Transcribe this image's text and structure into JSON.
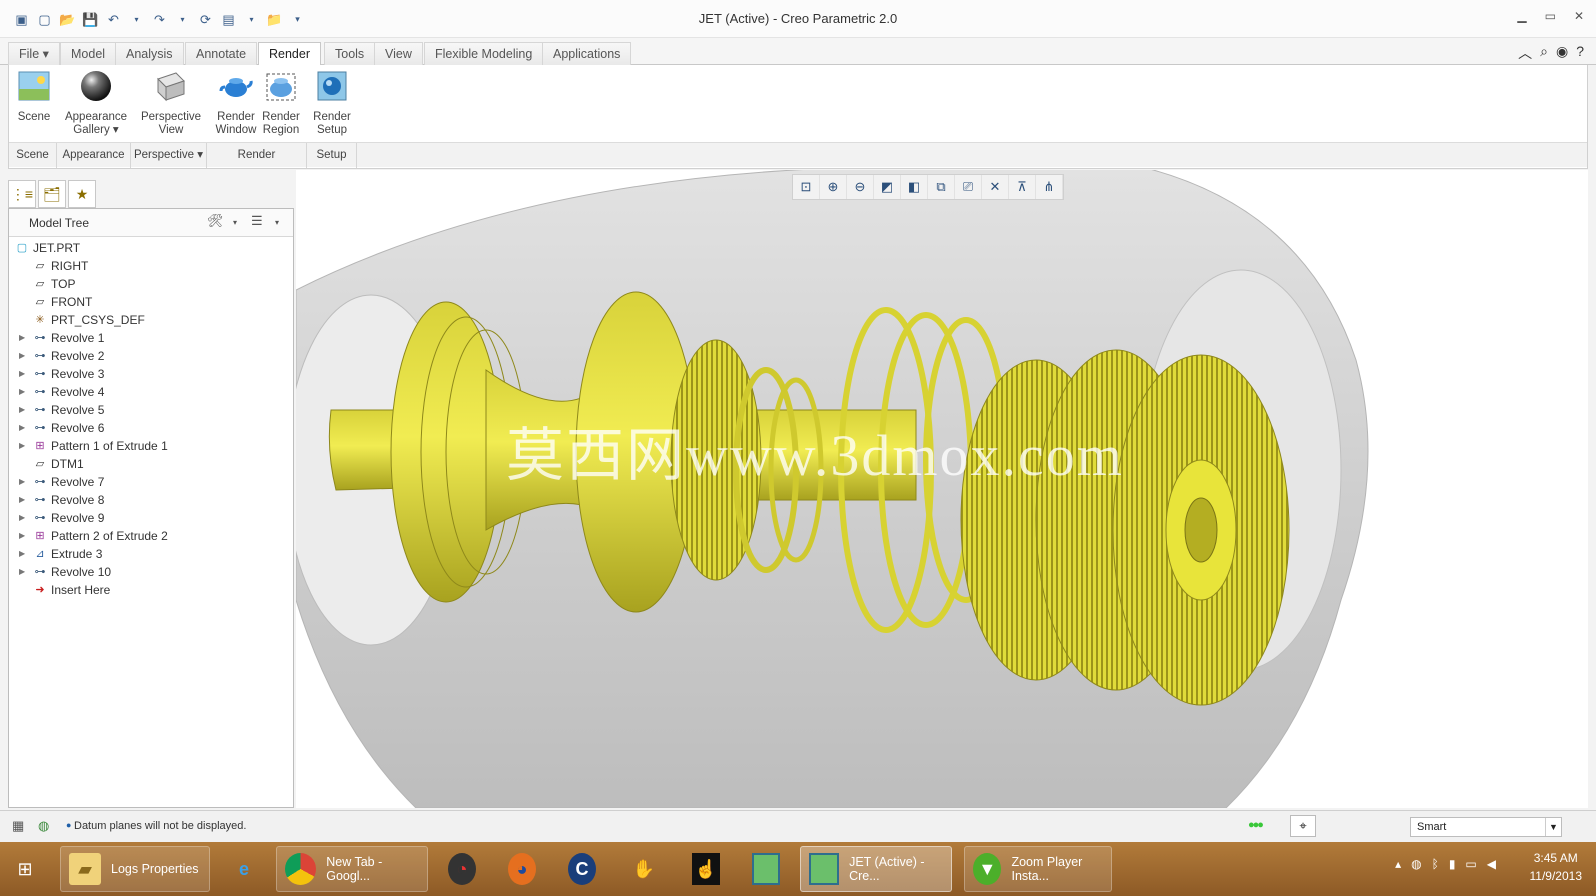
{
  "window": {
    "title": "JET (Active) - Creo Parametric 2.0"
  },
  "quick_access": [
    "new-icon",
    "open-icon",
    "save-icon",
    "undo-icon",
    "redo-icon",
    "regenerate-icon",
    "windows-icon",
    "close-icon",
    "customize-icon"
  ],
  "tabs": [
    {
      "label": "File ▾",
      "active": false
    },
    {
      "label": "Model",
      "active": false
    },
    {
      "label": "Analysis",
      "active": false
    },
    {
      "label": "Annotate",
      "active": false
    },
    {
      "label": "Render",
      "active": true
    },
    {
      "label": "Tools",
      "active": false
    },
    {
      "label": "View",
      "active": false
    },
    {
      "label": "Flexible Modeling",
      "active": false
    },
    {
      "label": "Applications",
      "active": false
    }
  ],
  "ribbon": {
    "buttons": [
      {
        "label1": "Scene",
        "label2": ""
      },
      {
        "label1": "Appearance",
        "label2": "Gallery ▾"
      },
      {
        "label1": "Perspective",
        "label2": "View"
      },
      {
        "label1": "Render",
        "label2": "Window"
      },
      {
        "label1": "Render",
        "label2": "Region"
      },
      {
        "label1": "Render",
        "label2": "Setup"
      }
    ],
    "groups": [
      "Scene",
      "Appearance",
      "Perspective ▾",
      "Render",
      "Setup"
    ]
  },
  "model_tree": {
    "title": "Model Tree",
    "items": [
      {
        "label": "JET.PRT",
        "expandable": false,
        "icon": "part-icon",
        "level": 0
      },
      {
        "label": "RIGHT",
        "expandable": false,
        "icon": "datum-plane-icon",
        "level": 1
      },
      {
        "label": "TOP",
        "expandable": false,
        "icon": "datum-plane-icon",
        "level": 1
      },
      {
        "label": "FRONT",
        "expandable": false,
        "icon": "datum-plane-icon",
        "level": 1
      },
      {
        "label": "PRT_CSYS_DEF",
        "expandable": false,
        "icon": "csys-icon",
        "level": 1
      },
      {
        "label": "Revolve 1",
        "expandable": true,
        "icon": "revolve-icon",
        "level": 1
      },
      {
        "label": "Revolve 2",
        "expandable": true,
        "icon": "revolve-icon",
        "level": 1
      },
      {
        "label": "Revolve 3",
        "expandable": true,
        "icon": "revolve-icon",
        "level": 1
      },
      {
        "label": "Revolve 4",
        "expandable": true,
        "icon": "revolve-icon",
        "level": 1
      },
      {
        "label": "Revolve 5",
        "expandable": true,
        "icon": "revolve-icon",
        "level": 1
      },
      {
        "label": "Revolve 6",
        "expandable": true,
        "icon": "revolve-icon",
        "level": 1
      },
      {
        "label": "Pattern 1 of Extrude 1",
        "expandable": true,
        "icon": "pattern-icon",
        "level": 1
      },
      {
        "label": "DTM1",
        "expandable": false,
        "icon": "datum-plane-icon",
        "level": 1
      },
      {
        "label": "Revolve 7",
        "expandable": true,
        "icon": "revolve-icon",
        "level": 1
      },
      {
        "label": "Revolve 8",
        "expandable": true,
        "icon": "revolve-icon",
        "level": 1
      },
      {
        "label": "Revolve 9",
        "expandable": true,
        "icon": "revolve-icon",
        "level": 1
      },
      {
        "label": "Pattern 2 of Extrude 2",
        "expandable": true,
        "icon": "pattern-icon",
        "level": 1
      },
      {
        "label": "Extrude 3",
        "expandable": true,
        "icon": "extrude-icon",
        "level": 1
      },
      {
        "label": "Revolve 10",
        "expandable": true,
        "icon": "revolve-icon",
        "level": 1
      },
      {
        "label": "Insert Here",
        "expandable": false,
        "icon": "insert-arrow-icon",
        "level": 1
      }
    ]
  },
  "graphics": {
    "watermark": "莫西网www.3dmox.com",
    "toolbar": [
      "refit-icon",
      "zoom-in-icon",
      "zoom-out-icon",
      "repaint-icon",
      "display-style-icon",
      "saved-orientations-icon",
      "view-manager-icon",
      "datum-display-icon",
      "spin-center-icon",
      "annotation-display-icon"
    ]
  },
  "status": {
    "message": "Datum planes will not be displayed.",
    "filter": "Smart"
  },
  "taskbar": {
    "items": [
      {
        "label": "Logs Properties",
        "icon": "folder-icon"
      },
      {
        "label": "New Tab - Googl...",
        "icon": "chrome-icon"
      },
      {
        "label": "JET (Active) - Cre...",
        "icon": "creo-icon"
      },
      {
        "label": "Zoom Player Insta...",
        "icon": "zoom-player-icon"
      }
    ],
    "time": "3:45 AM",
    "date": "11/9/2013"
  },
  "colors": {
    "model_yellow": "#e8e43a",
    "housing_gray": "#c9c9c9",
    "accent": "#1f5fa8"
  }
}
